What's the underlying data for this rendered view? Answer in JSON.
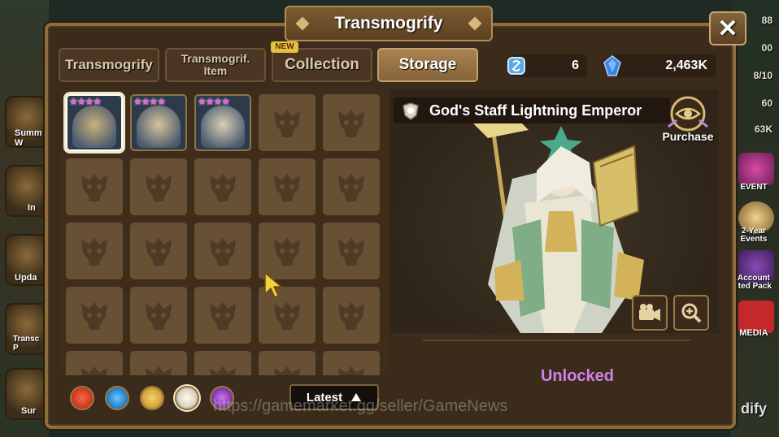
{
  "window": {
    "title": "Transmogrify",
    "close_label": "✕"
  },
  "tabs": [
    {
      "label": "Transmogrify",
      "active": false
    },
    {
      "label": "Transmogrif.\nItem",
      "active": false
    },
    {
      "label": "Collection",
      "active": false,
      "badge": "NEW"
    },
    {
      "label": "Storage",
      "active": true
    }
  ],
  "currency": [
    {
      "icon": "transmog-stone-icon",
      "value": "6",
      "color": "#5aa8e6"
    },
    {
      "icon": "crystal-icon",
      "value": "2,463K",
      "color": "#3d84e0"
    }
  ],
  "grid": {
    "items": [
      {
        "stars": "★★★★",
        "selected": true,
        "portrait_color": "#c9b27a"
      },
      {
        "stars": "★★★★",
        "selected": false,
        "portrait_color": "#d9c39a"
      },
      {
        "stars": "★★★★",
        "selected": false,
        "portrait_color": "#d8cfb4"
      }
    ],
    "empty_icon": "monster-silhouette-icon"
  },
  "filters": [
    {
      "name": "fire-element-icon",
      "color": "#d63a22"
    },
    {
      "name": "water-element-icon",
      "color": "#2a86c9"
    },
    {
      "name": "wind-element-icon",
      "color": "#d8a637"
    },
    {
      "name": "light-element-icon",
      "color": "#d8d2c2"
    },
    {
      "name": "dark-element-icon",
      "color": "#8a3ab0"
    }
  ],
  "sort": {
    "label": "Latest"
  },
  "watermark": "https://gamemarket.gg/seller/GameNews",
  "preview": {
    "name": "God's Staff Lightning Emperor",
    "purchase_label": "Purchase",
    "status": "Unlocked"
  },
  "background": {
    "left_labels": [
      "Summ\nW",
      "In",
      "Upda",
      "Transc\nP",
      "Sur"
    ],
    "right_numbers": [
      "88",
      "00",
      "8/10",
      "60",
      "63K"
    ],
    "right_labels": [
      "EVENT",
      "2-Year\nEvents",
      "Account\nited Pack",
      "MEDIA",
      "dify"
    ]
  }
}
